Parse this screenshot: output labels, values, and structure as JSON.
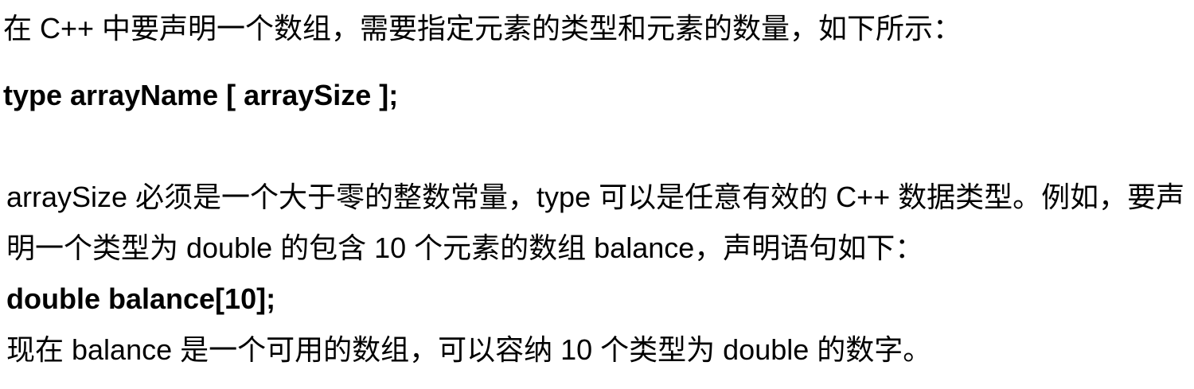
{
  "document": {
    "intro_line": "在 C++ 中要声明一个数组，需要指定元素的类型和元素的数量，如下所示：",
    "syntax_line": "type arrayName [ arraySize ];",
    "explanation_line_1": "arraySize 必须是一个大于零的整数常量，type 可以是任意有效的 C++ 数据类型。例如，要声",
    "explanation_line_2": "明一个类型为 double 的包含 10 个元素的数组 balance，声明语句如下：",
    "example_code": "double balance[10];",
    "conclusion_line": "现在 balance 是一个可用的数组，可以容纳 10 个类型为 double 的数字。"
  }
}
